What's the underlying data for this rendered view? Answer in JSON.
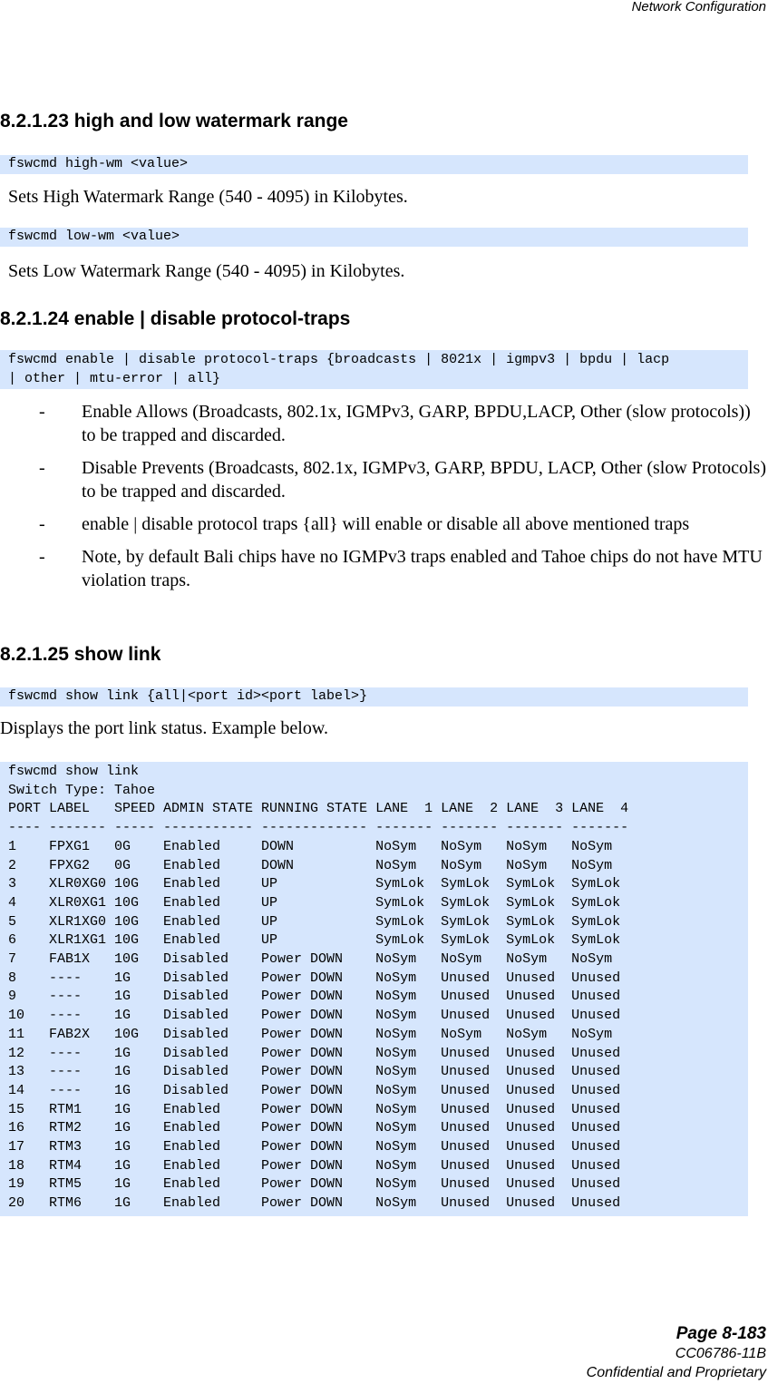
{
  "header": {
    "section_title": "Network Configuration"
  },
  "sections": {
    "s23": {
      "heading": "8.2.1.23 high and low watermark range",
      "cmd_high": "fswcmd high-wm <value>",
      "desc_high": "Sets High Watermark Range (540 - 4095) in Kilobytes.",
      "cmd_low": "fswcmd low-wm <value>",
      "desc_low": "Sets Low Watermark Range (540 - 4095) in Kilobytes."
    },
    "s24": {
      "heading": "8.2.1.24 enable | disable protocol-traps",
      "cmd_line1": "fswcmd enable | disable protocol-traps {broadcasts | 8021x | igmpv3 | bpdu | lacp",
      "cmd_line2": "| other | mtu-error | all}",
      "bullets": [
        {
          "dash": "-",
          "text": "Enable Allows (Broadcasts, 802.1x, IGMPv3, GARP, BPDU,LACP, Other (slow protocols)) to be trapped and discarded."
        },
        {
          "dash": "-",
          "text": "Disable Prevents (Broadcasts, 802.1x, IGMPv3, GARP, BPDU, LACP, Other (slow Protocols) to be trapped and discarded."
        },
        {
          "dash": "-",
          "text": "enable | disable protocol traps {all} will enable or disable all above mentioned traps"
        },
        {
          "dash": "-",
          "text": "Note, by default Bali chips have no IGMPv3 traps enabled and Tahoe chips do not have MTU violation traps."
        }
      ]
    },
    "s25": {
      "heading": "8.2.1.25 show link",
      "cmd": "fswcmd show link {all|<port id><port label>}",
      "desc": "Displays the port link status. Example below.",
      "example": {
        "command": "fswcmd show link",
        "switch_type": "Switch Type: Tahoe",
        "header_row": "PORT LABEL   SPEED ADMIN STATE RUNNING STATE LANE  1 LANE  2 LANE  3 LANE  4",
        "separator_row": "---- ------- ----- ----------- ------------- ------- ------- ------- -------",
        "columns": [
          "PORT",
          "LABEL",
          "SPEED",
          "ADMIN STATE",
          "RUNNING STATE",
          "LANE  1",
          "LANE  2",
          "LANE  3",
          "LANE  4"
        ],
        "rows": [
          [
            "1",
            "FPXG1",
            "0G",
            "Enabled",
            "DOWN",
            "NoSym",
            "NoSym",
            "NoSym",
            "NoSym"
          ],
          [
            "2",
            "FPXG2",
            "0G",
            "Enabled",
            "DOWN",
            "NoSym",
            "NoSym",
            "NoSym",
            "NoSym"
          ],
          [
            "3",
            "XLR0XG0",
            "10G",
            "Enabled",
            "UP",
            "SymLok",
            "SymLok",
            "SymLok",
            "SymLok"
          ],
          [
            "4",
            "XLR0XG1",
            "10G",
            "Enabled",
            "UP",
            "SymLok",
            "SymLok",
            "SymLok",
            "SymLok"
          ],
          [
            "5",
            "XLR1XG0",
            "10G",
            "Enabled",
            "UP",
            "SymLok",
            "SymLok",
            "SymLok",
            "SymLok"
          ],
          [
            "6",
            "XLR1XG1",
            "10G",
            "Enabled",
            "UP",
            "SymLok",
            "SymLok",
            "SymLok",
            "SymLok"
          ],
          [
            "7",
            "FAB1X",
            "10G",
            "Disabled",
            "Power DOWN",
            "NoSym",
            "NoSym",
            "NoSym",
            "NoSym"
          ],
          [
            "8",
            "----",
            "1G",
            "Disabled",
            "Power DOWN",
            "NoSym",
            "Unused",
            "Unused",
            "Unused"
          ],
          [
            "9",
            "----",
            "1G",
            "Disabled",
            "Power DOWN",
            "NoSym",
            "Unused",
            "Unused",
            "Unused"
          ],
          [
            "10",
            "----",
            "1G",
            "Disabled",
            "Power DOWN",
            "NoSym",
            "Unused",
            "Unused",
            "Unused"
          ],
          [
            "11",
            "FAB2X",
            "10G",
            "Disabled",
            "Power DOWN",
            "NoSym",
            "NoSym",
            "NoSym",
            "NoSym"
          ],
          [
            "12",
            "----",
            "1G",
            "Disabled",
            "Power DOWN",
            "NoSym",
            "Unused",
            "Unused",
            "Unused"
          ],
          [
            "13",
            "----",
            "1G",
            "Disabled",
            "Power DOWN",
            "NoSym",
            "Unused",
            "Unused",
            "Unused"
          ],
          [
            "14",
            "----",
            "1G",
            "Disabled",
            "Power DOWN",
            "NoSym",
            "Unused",
            "Unused",
            "Unused"
          ],
          [
            "15",
            "RTM1",
            "1G",
            "Enabled",
            "Power DOWN",
            "NoSym",
            "Unused",
            "Unused",
            "Unused"
          ],
          [
            "16",
            "RTM2",
            "1G",
            "Enabled",
            "Power DOWN",
            "NoSym",
            "Unused",
            "Unused",
            "Unused"
          ],
          [
            "17",
            "RTM3",
            "1G",
            "Enabled",
            "Power DOWN",
            "NoSym",
            "Unused",
            "Unused",
            "Unused"
          ],
          [
            "18",
            "RTM4",
            "1G",
            "Enabled",
            "Power DOWN",
            "NoSym",
            "Unused",
            "Unused",
            "Unused"
          ],
          [
            "19",
            "RTM5",
            "1G",
            "Enabled",
            "Power DOWN",
            "NoSym",
            "Unused",
            "Unused",
            "Unused"
          ],
          [
            "20",
            "RTM6",
            "1G",
            "Enabled",
            "Power DOWN",
            "NoSym",
            "Unused",
            "Unused",
            "Unused"
          ]
        ]
      }
    }
  },
  "footer": {
    "page": "Page 8-183",
    "doc_id": "CC06786-11B",
    "confidentiality": "Confidential and Proprietary"
  },
  "colors": {
    "code_background": "#d6e6fd"
  }
}
